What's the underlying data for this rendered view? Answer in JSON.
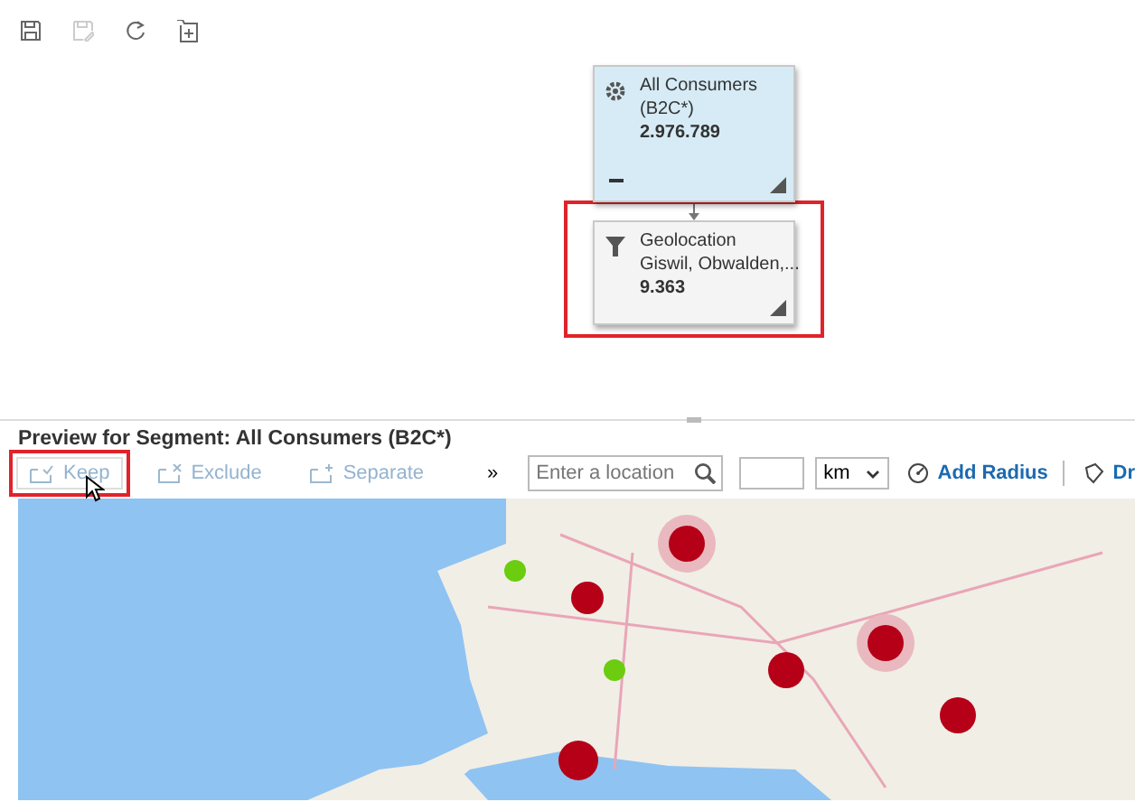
{
  "toolbar": {
    "buttons": [
      {
        "kind": "save",
        "disabled": false
      },
      {
        "kind": "save-as",
        "disabled": true
      },
      {
        "kind": "refresh",
        "disabled": false
      },
      {
        "kind": "add",
        "disabled": false
      }
    ]
  },
  "diagram": {
    "nodes": [
      {
        "kind": "segment",
        "title": "All Consumers",
        "subtitle": "(B2C*)",
        "count": "2.976.789",
        "highlighted": false
      },
      {
        "kind": "filter",
        "title": "Geolocation",
        "subtitle": "Giswil, Obwalden,...",
        "count": "9.363",
        "highlighted": true
      }
    ]
  },
  "preview": {
    "title": "Preview for Segment: All Consumers (B2C*)",
    "actions": [
      {
        "kind": "keep",
        "label": "Keep",
        "highlighted": true
      },
      {
        "kind": "exclude",
        "label": "Exclude",
        "highlighted": false
      },
      {
        "kind": "separate",
        "label": "Separate",
        "highlighted": false
      }
    ],
    "overflow": "»",
    "location": {
      "placeholder": "Enter a location"
    },
    "unit": "km",
    "add_radius": "Add Radius",
    "draw": "Dr"
  }
}
